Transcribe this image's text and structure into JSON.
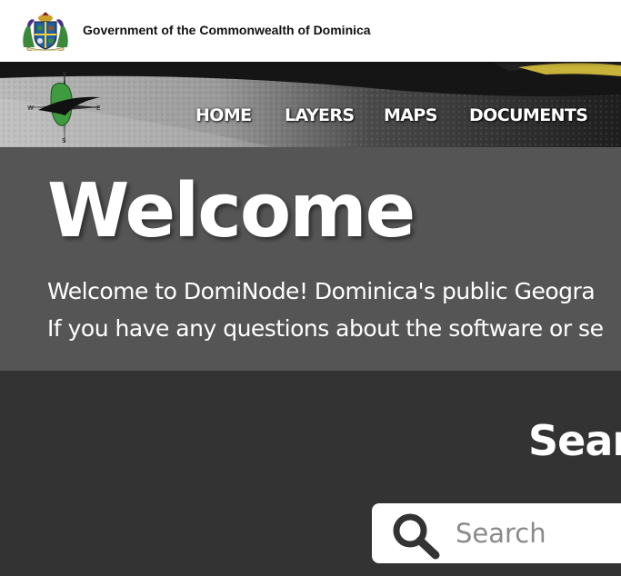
{
  "gov_bar": {
    "title": "Government of the Commonwealth of Dominica",
    "crest_icon": "coat-of-arms-icon"
  },
  "navbar": {
    "logo_icon": "dominode-compass-logo",
    "items": [
      {
        "label": "HOME"
      },
      {
        "label": "LAYERS"
      },
      {
        "label": "MAPS"
      },
      {
        "label": "DOCUMENTS"
      }
    ]
  },
  "hero": {
    "title": "Welcome",
    "line1": "Welcome to DomiNode! Dominica's public Geogra",
    "line2": "If you have any questions about the software or se"
  },
  "search": {
    "heading": "Sear",
    "placeholder": "Search",
    "value": "",
    "icon": "search-icon"
  },
  "colors": {
    "gov_bar_bg": "#ffffff",
    "hero_bg": "#555555",
    "search_section_bg": "#333333",
    "text_light": "#ffffff"
  }
}
